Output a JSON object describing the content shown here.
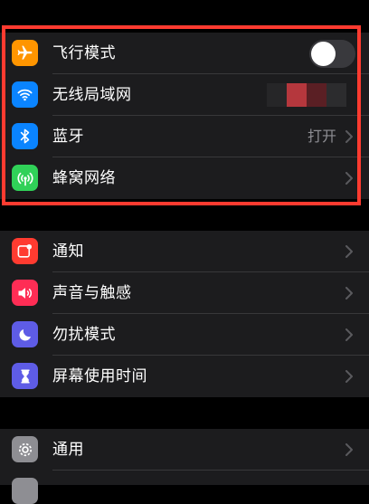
{
  "section1": {
    "airplane": {
      "label": "飞行模式",
      "icon": "airplane-icon",
      "color": "#ff9500",
      "toggle_on": false
    },
    "wifi": {
      "label": "无线局域网",
      "icon": "wifi-icon",
      "color": "#0a84ff"
    },
    "bluetooth": {
      "label": "蓝牙",
      "value": "打开",
      "icon": "bluetooth-icon",
      "color": "#0a84ff"
    },
    "cellular": {
      "label": "蜂窝网络",
      "icon": "cellular-antenna-icon",
      "color": "#30d158"
    }
  },
  "section2": {
    "notifications": {
      "label": "通知",
      "icon": "notifications-icon",
      "color": "#ff3b30"
    },
    "sounds": {
      "label": "声音与触感",
      "icon": "speaker-icon",
      "color": "#ff2d55"
    },
    "dnd": {
      "label": "勿扰模式",
      "icon": "moon-icon",
      "color": "#5e5ce6"
    },
    "screentime": {
      "label": "屏幕使用时间",
      "icon": "hourglass-icon",
      "color": "#5e5ce6"
    }
  },
  "section3": {
    "general": {
      "label": "通用",
      "icon": "gear-icon",
      "color": "#8e8e93"
    }
  },
  "highlight_color": "#ff3b30"
}
